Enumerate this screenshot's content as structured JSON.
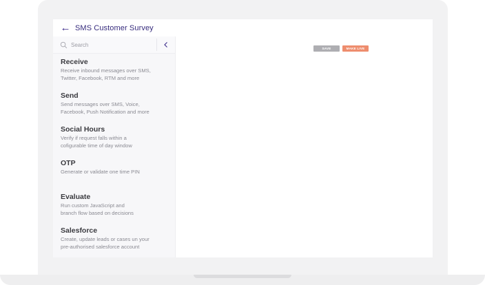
{
  "app": {
    "title": "SMS Customer Survey"
  },
  "search": {
    "placeholder": "Search"
  },
  "nodes": [
    {
      "title": "Receive",
      "description": "Receive inbound messages over SMS,\nTwitter, Facebook, RTM and more"
    },
    {
      "title": "Send",
      "description": "Send messages over SMS, Voice,\nFacebook, Push Notification and more"
    },
    {
      "title": "Social Hours",
      "description": "Verify if request falls within a\ncofigurable time of day window"
    },
    {
      "title": "OTP",
      "description": "Generate or validate one time PIN"
    },
    {
      "title": "Evaluate",
      "description": "Run custom JavaScript and\nbranch flow based on decisions"
    },
    {
      "title": "Salesforce",
      "description": "Create, update leads or cases un your\npre-authorised salesforce account"
    }
  ],
  "toolbar": {
    "save_label": "SAVE",
    "make_live_label": "MAKE LIVE"
  },
  "colors": {
    "title": "#352a7c",
    "save_button": "#aeaeb2",
    "make_live_button": "#ee8d6e"
  },
  "icons": {
    "back": "arrow-left-icon",
    "search": "search-icon",
    "collapse": "chevron-left-icon"
  }
}
